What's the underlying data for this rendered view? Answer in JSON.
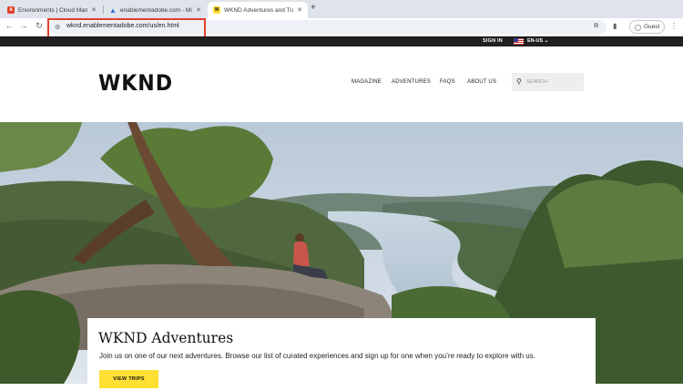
{
  "browser": {
    "tabs": [
      {
        "title": "Environments | Cloud Manag",
        "favicon": "adobe-red-icon",
        "active": false
      },
      {
        "title": "enablementadobe.com - Micr",
        "favicon": "triangle-blue-icon",
        "active": false
      },
      {
        "title": "WKND Adventures and Travel",
        "favicon": "wknd-yellow-icon",
        "active": true
      }
    ],
    "new_tab": "+",
    "url": "wknd.enablementadobe.com/us/en.html",
    "profile_label": "Guest",
    "colors": {
      "highlight": "#e0402a",
      "tabstrip": "#dfe3ea"
    }
  },
  "site": {
    "utility": {
      "signin": "SIGN IN",
      "language": "EN-US"
    },
    "logo": "WKND",
    "menu": [
      "MAGAZINE",
      "ADVENTURES",
      "FAQS",
      "ABOUT US"
    ],
    "search_placeholder": "SEARCH",
    "hero": {
      "title": "WKND Adventures",
      "description": "Join us on one of our next adventures. Browse our list of curated experiences and sign up for one when you’re ready to explore with us.",
      "cta": "VIEW TRIPS"
    },
    "colors": {
      "cta": "#ffe033",
      "utility_bar": "#202020"
    }
  }
}
